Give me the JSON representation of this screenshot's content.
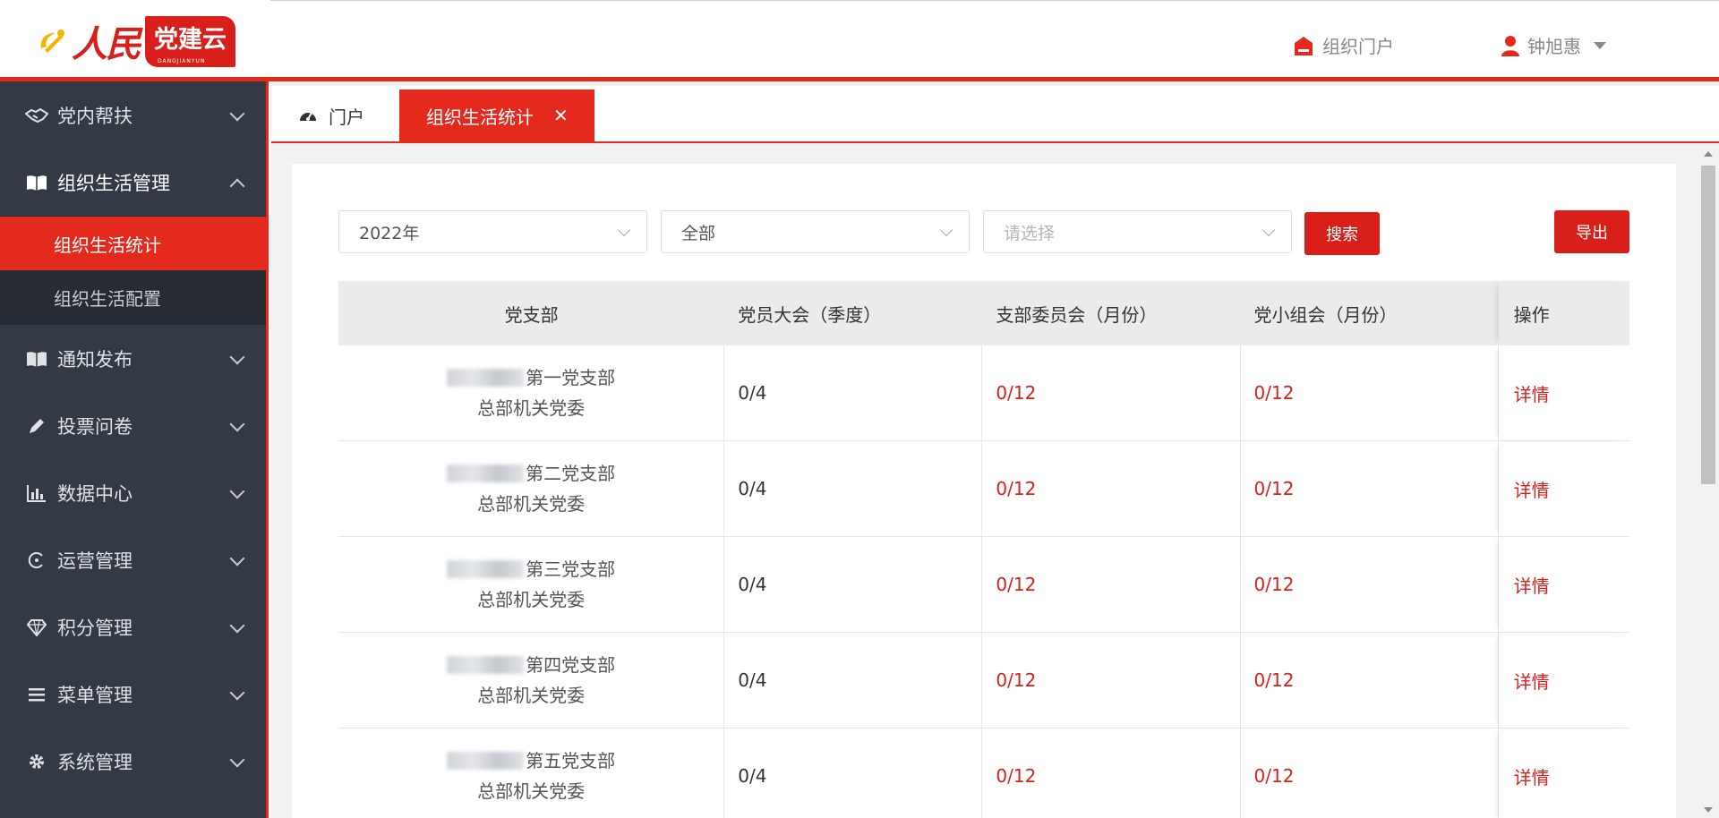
{
  "header": {
    "logo_script": "人民",
    "logo_flag": "党建云",
    "logo_sub": "DANGJIANYUN",
    "portal_label": "组织门户",
    "user_name": "钟旭惠"
  },
  "sidebar": {
    "items": [
      {
        "label": "党内帮扶",
        "icon": "handshake-icon"
      },
      {
        "label": "组织生活管理",
        "icon": "book-icon",
        "open": true
      },
      {
        "label": "通知发布",
        "icon": "book-icon"
      },
      {
        "label": "投票问卷",
        "icon": "pencil-icon"
      },
      {
        "label": "数据中心",
        "icon": "bar-chart-icon"
      },
      {
        "label": "运营管理",
        "icon": "cycle-icon"
      },
      {
        "label": "积分管理",
        "icon": "diamond-icon"
      },
      {
        "label": "菜单管理",
        "icon": "menu-icon"
      },
      {
        "label": "系统管理",
        "icon": "gear-icon"
      }
    ],
    "submenu": [
      {
        "label": "组织生活统计",
        "active": true
      },
      {
        "label": "组织生活配置",
        "active": false
      }
    ]
  },
  "tabs": {
    "portal_label": "门户",
    "active_label": "组织生活统计",
    "close_glyph": "✕"
  },
  "filters": {
    "year": "2022年",
    "scope": "全部",
    "placeholder": "请选择",
    "search_label": "搜索",
    "export_label": "导出"
  },
  "table": {
    "headers": [
      "党支部",
      "党员大会（季度）",
      "支部委员会（月份）",
      "党小组会（月份）",
      "操作"
    ],
    "rows": [
      {
        "branch": "第一党支部",
        "org": "总部机关党委",
        "meeting": "0/4",
        "committee": "0/12",
        "group": "0/12",
        "action": "详情"
      },
      {
        "branch": "第二党支部",
        "org": "总部机关党委",
        "meeting": "0/4",
        "committee": "0/12",
        "group": "0/12",
        "action": "详情"
      },
      {
        "branch": "第三党支部",
        "org": "总部机关党委",
        "meeting": "0/4",
        "committee": "0/12",
        "group": "0/12",
        "action": "详情"
      },
      {
        "branch": "第四党支部",
        "org": "总部机关党委",
        "meeting": "0/4",
        "committee": "0/12",
        "group": "0/12",
        "action": "详情"
      },
      {
        "branch": "第五党支部",
        "org": "总部机关党委",
        "meeting": "0/4",
        "committee": "0/12",
        "group": "0/12",
        "action": "详情"
      }
    ]
  },
  "colors": {
    "accent": "#e32a1c",
    "sidebar_bg": "#343a45",
    "submenu_bg": "#272b33"
  }
}
